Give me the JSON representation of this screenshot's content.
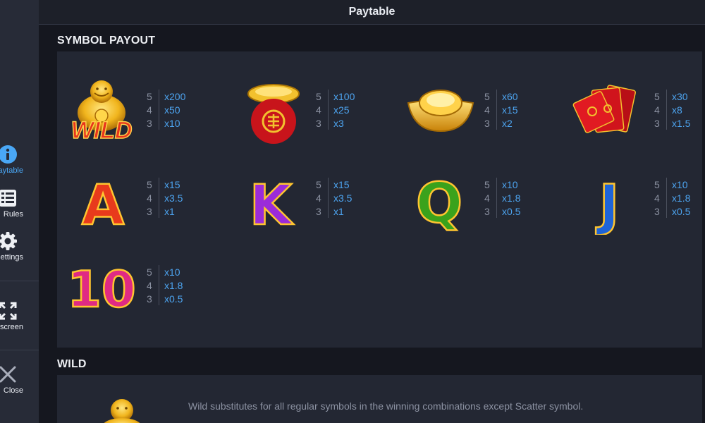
{
  "header": {
    "title": "Paytable"
  },
  "sidebar": {
    "items": [
      {
        "label": "Paytable",
        "icon": "info-icon",
        "active": true
      },
      {
        "label": "Rules",
        "icon": "list-icon",
        "active": false
      },
      {
        "label": "Settings",
        "icon": "gear-icon",
        "active": false
      },
      {
        "label": "Fullscreen",
        "icon": "fullscreen-icon",
        "active": false
      },
      {
        "label": "Close",
        "icon": "close-icon",
        "active": false
      }
    ]
  },
  "symbol_payout": {
    "title": "SYMBOL PAYOUT",
    "symbols": [
      {
        "name": "buddha-wild",
        "image_text": "WILD",
        "payouts": [
          {
            "count": "5",
            "mult": "x200"
          },
          {
            "count": "4",
            "mult": "x50"
          },
          {
            "count": "3",
            "mult": "x10"
          }
        ]
      },
      {
        "name": "money-bag",
        "image_text": "",
        "payouts": [
          {
            "count": "5",
            "mult": "x100"
          },
          {
            "count": "4",
            "mult": "x25"
          },
          {
            "count": "3",
            "mult": "x3"
          }
        ]
      },
      {
        "name": "gold-ingot",
        "image_text": "",
        "payouts": [
          {
            "count": "5",
            "mult": "x60"
          },
          {
            "count": "4",
            "mult": "x15"
          },
          {
            "count": "3",
            "mult": "x2"
          }
        ]
      },
      {
        "name": "red-envelopes",
        "image_text": "",
        "payouts": [
          {
            "count": "5",
            "mult": "x30"
          },
          {
            "count": "4",
            "mult": "x8"
          },
          {
            "count": "3",
            "mult": "x1.5"
          }
        ]
      },
      {
        "name": "letter-a",
        "image_text": "A",
        "payouts": [
          {
            "count": "5",
            "mult": "x15"
          },
          {
            "count": "4",
            "mult": "x3.5"
          },
          {
            "count": "3",
            "mult": "x1"
          }
        ]
      },
      {
        "name": "letter-k",
        "image_text": "K",
        "payouts": [
          {
            "count": "5",
            "mult": "x15"
          },
          {
            "count": "4",
            "mult": "x3.5"
          },
          {
            "count": "3",
            "mult": "x1"
          }
        ]
      },
      {
        "name": "letter-q",
        "image_text": "Q",
        "payouts": [
          {
            "count": "5",
            "mult": "x10"
          },
          {
            "count": "4",
            "mult": "x1.8"
          },
          {
            "count": "3",
            "mult": "x0.5"
          }
        ]
      },
      {
        "name": "letter-j",
        "image_text": "J",
        "payouts": [
          {
            "count": "5",
            "mult": "x10"
          },
          {
            "count": "4",
            "mult": "x1.8"
          },
          {
            "count": "3",
            "mult": "x0.5"
          }
        ]
      },
      {
        "name": "number-10",
        "image_text": "10",
        "payouts": [
          {
            "count": "5",
            "mult": "x10"
          },
          {
            "count": "4",
            "mult": "x1.8"
          },
          {
            "count": "3",
            "mult": "x0.5"
          }
        ]
      }
    ]
  },
  "wild": {
    "title": "WILD",
    "description": "Wild substitutes for all regular symbols in the winning combinations except Scatter symbol."
  },
  "colors": {
    "accent": "#4aa7f5",
    "panel": "#232733",
    "background": "#15171f",
    "sidebar": "#272b37"
  }
}
